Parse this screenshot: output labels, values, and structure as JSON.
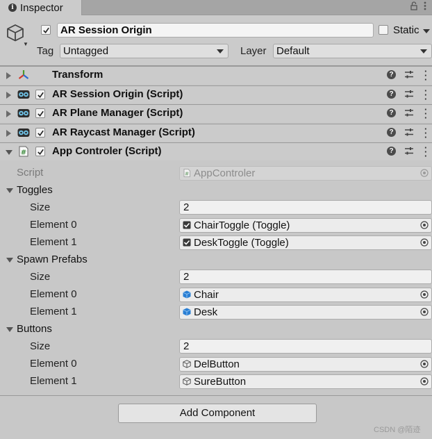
{
  "tab": {
    "title": "Inspector"
  },
  "object": {
    "active": true,
    "name": "AR Session Origin",
    "static_label": "Static",
    "static_checked": false,
    "tag_label": "Tag",
    "tag_value": "Untagged",
    "layer_label": "Layer",
    "layer_value": "Default"
  },
  "components": [
    {
      "title": "Transform",
      "icon": "transform-icon",
      "has_checkbox": false,
      "expanded": false
    },
    {
      "title": "AR Session Origin (Script)",
      "icon": "script-component-icon",
      "has_checkbox": true,
      "expanded": false
    },
    {
      "title": "AR Plane Manager (Script)",
      "icon": "script-component-icon",
      "has_checkbox": true,
      "expanded": false
    },
    {
      "title": "AR Raycast Manager (Script)",
      "icon": "script-component-icon",
      "has_checkbox": true,
      "expanded": false
    },
    {
      "title": "App Controler (Script)",
      "icon": "csharp-script-icon",
      "has_checkbox": true,
      "expanded": true
    }
  ],
  "app_controler": {
    "script_label": "Script",
    "script_value": "AppControler",
    "toggles": {
      "label": "Toggles",
      "size_label": "Size",
      "size": "2",
      "elements": [
        {
          "label": "Element 0",
          "value": "ChairToggle (Toggle)",
          "icon": "toggle-icon"
        },
        {
          "label": "Element 1",
          "value": "DeskToggle (Toggle)",
          "icon": "toggle-icon"
        }
      ]
    },
    "spawn_prefabs": {
      "label": "Spawn Prefabs",
      "size_label": "Size",
      "size": "2",
      "elements": [
        {
          "label": "Element 0",
          "value": "Chair",
          "icon": "prefab-icon"
        },
        {
          "label": "Element 1",
          "value": "Desk",
          "icon": "prefab-icon"
        }
      ]
    },
    "buttons": {
      "label": "Buttons",
      "size_label": "Size",
      "size": "2",
      "elements": [
        {
          "label": "Element 0",
          "value": "DelButton",
          "icon": "gameobject-icon"
        },
        {
          "label": "Element 1",
          "value": "SureButton",
          "icon": "gameobject-icon"
        }
      ]
    }
  },
  "add_component_label": "Add Component",
  "watermark": "CSDN @陌迹",
  "colors": {
    "panel": "#c8c8c8",
    "header": "#cbcbcb",
    "prefab_blue": "#2a7fd4",
    "script_green": "#3b8a3b"
  }
}
